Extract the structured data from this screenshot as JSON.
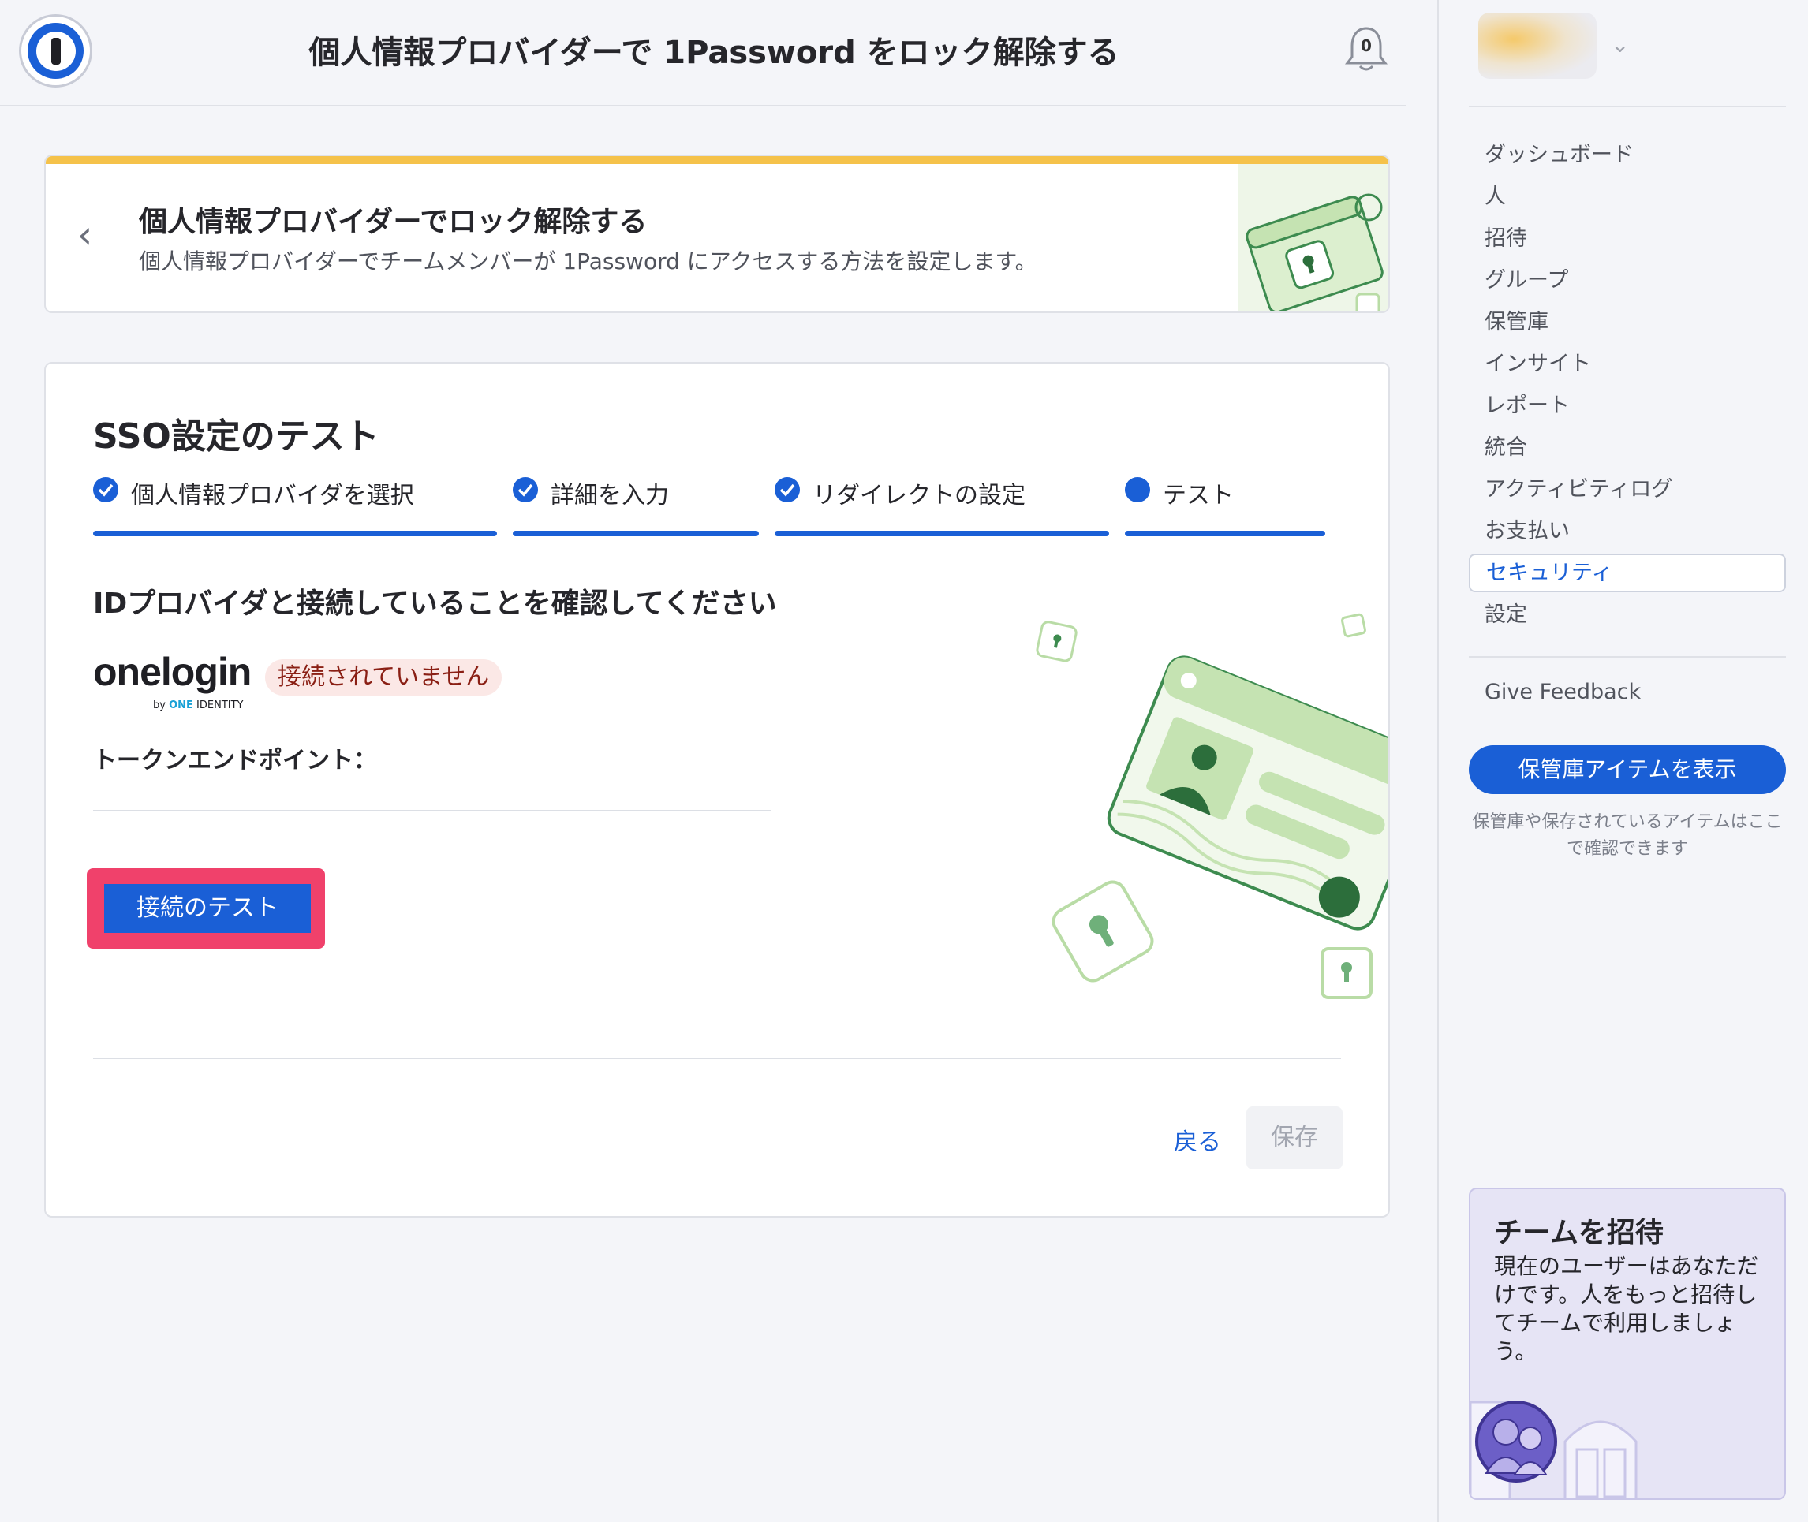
{
  "header": {
    "title": "個人情報プロバイダーで 1Password をロック解除する",
    "notification_count": "0"
  },
  "intro_card": {
    "title": "個人情報プロバイダーでロック解除する",
    "subtitle": "個人情報プロバイダーでチームメンバーが 1Password にアクセスする方法を設定します。"
  },
  "sso_card": {
    "title": "SSO設定のテスト",
    "steps": [
      {
        "label": "個人情報プロバイダを選択",
        "status": "complete"
      },
      {
        "label": "詳細を入力",
        "status": "complete"
      },
      {
        "label": "リダイレクトの設定",
        "status": "complete"
      },
      {
        "label": "テスト",
        "status": "current"
      }
    ],
    "confirm_heading": "IDプロバイダと接続していることを確認してください",
    "provider": {
      "logo_word": "onelogin",
      "logo_by": "by",
      "logo_one": "ONE",
      "logo_identity": "IDENTITY",
      "status": "接続されていません"
    },
    "token_endpoint_label": "トークンエンドポイント：",
    "token_endpoint_value": "",
    "test_button": "接続のテスト",
    "back_link": "戻る",
    "save_button": "保存"
  },
  "sidebar": {
    "nav": [
      {
        "label": "ダッシュボード",
        "active": false
      },
      {
        "label": "人",
        "active": false
      },
      {
        "label": "招待",
        "active": false
      },
      {
        "label": "グループ",
        "active": false
      },
      {
        "label": "保管庫",
        "active": false
      },
      {
        "label": "インサイト",
        "active": false
      },
      {
        "label": "レポート",
        "active": false
      },
      {
        "label": "統合",
        "active": false
      },
      {
        "label": "アクティビティログ",
        "active": false
      },
      {
        "label": "お支払い",
        "active": false
      },
      {
        "label": "セキュリティ",
        "active": true
      },
      {
        "label": "設定",
        "active": false
      }
    ],
    "feedback": "Give Feedback",
    "vault_button": "保管庫アイテムを表示",
    "vault_note": "保管庫や保存されているアイテムはここで確認できます",
    "invite": {
      "title": "チームを招待",
      "text": "現在のユーザーはあなただけです。人をもっと招待してチームで利用しましょう。"
    }
  },
  "colors": {
    "accent_blue": "#1a5fd6",
    "highlight": "#f0416b",
    "banner_yellow": "#f5c24a",
    "error_badge_bg": "#fbe8e6"
  }
}
